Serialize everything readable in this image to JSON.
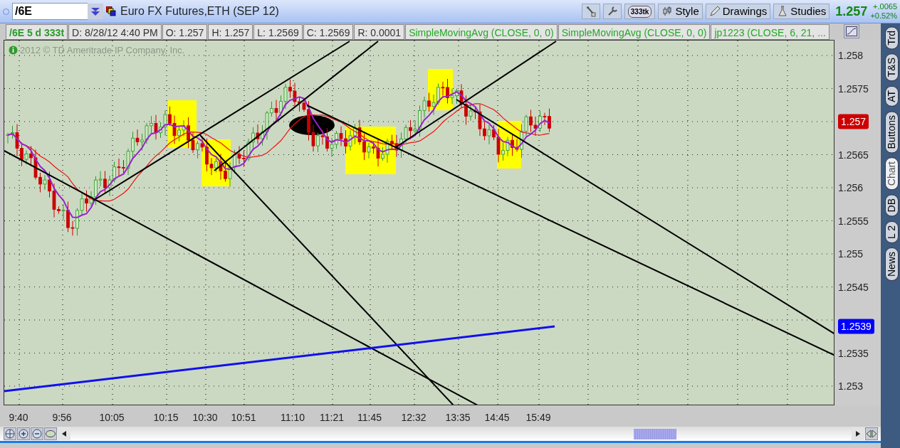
{
  "symbol": {
    "value": "/6E"
  },
  "instrument": "Euro FX Futures,ETH (SEP 12)",
  "toolbar": [
    {
      "kind": "badge",
      "label": "333tk"
    },
    {
      "kind": "style",
      "label": "Style"
    },
    {
      "kind": "drawings",
      "label": "Drawings"
    },
    {
      "kind": "studies",
      "label": "Studies"
    }
  ],
  "quote": {
    "last": "1.257",
    "change": "+.0065",
    "change_pct": "+0.52%"
  },
  "info_bar": [
    {
      "kind": "symbol",
      "text": "/6E 5 d 333t"
    },
    {
      "kind": "field",
      "text": "D: 8/28/12 4:40 PM"
    },
    {
      "kind": "field",
      "text": "O: 1.257"
    },
    {
      "kind": "field",
      "text": "H: 1.257"
    },
    {
      "kind": "field",
      "text": "L: 1.2569"
    },
    {
      "kind": "field",
      "text": "C: 1.2569"
    },
    {
      "kind": "field",
      "text": "R: 0.0001"
    },
    {
      "kind": "study",
      "text": "SimpleMovingAvg (CLOSE, 0, 0)"
    },
    {
      "kind": "study",
      "text": "SimpleMovingAvg (CLOSE, 0, 0)"
    },
    {
      "kind": "study",
      "text": "jp1223 (CLOSE, 6, 21, ..."
    }
  ],
  "chart": {
    "copyright": "2012 © TD Ameritrade IP Company, Inc.",
    "y_ticks": [
      "1.258",
      "1.2575",
      "1.2565",
      "1.256",
      "1.2555",
      "1.255",
      "1.2545",
      "1.2535",
      "1.253"
    ],
    "price_tags": [
      {
        "label": "1.257",
        "color": "#cc0000"
      },
      {
        "label": "1.2539",
        "color": "#0000ff"
      }
    ],
    "x_ticks": [
      "9:40",
      "9:56",
      "10:05",
      "10:15",
      "10:30",
      "10:51",
      "11:10",
      "11:21",
      "11:45",
      "12:32",
      "13:35",
      "14:45",
      "15:49"
    ]
  },
  "side_tabs": [
    {
      "label": "Trd",
      "selected": false
    },
    {
      "label": "T&S",
      "selected": false
    },
    {
      "label": "AT",
      "selected": false
    },
    {
      "label": "Buttons",
      "selected": false
    },
    {
      "label": "Chart",
      "selected": true
    },
    {
      "label": "DB",
      "selected": false
    },
    {
      "label": "L 2",
      "selected": false
    },
    {
      "label": "News",
      "selected": false
    }
  ]
}
